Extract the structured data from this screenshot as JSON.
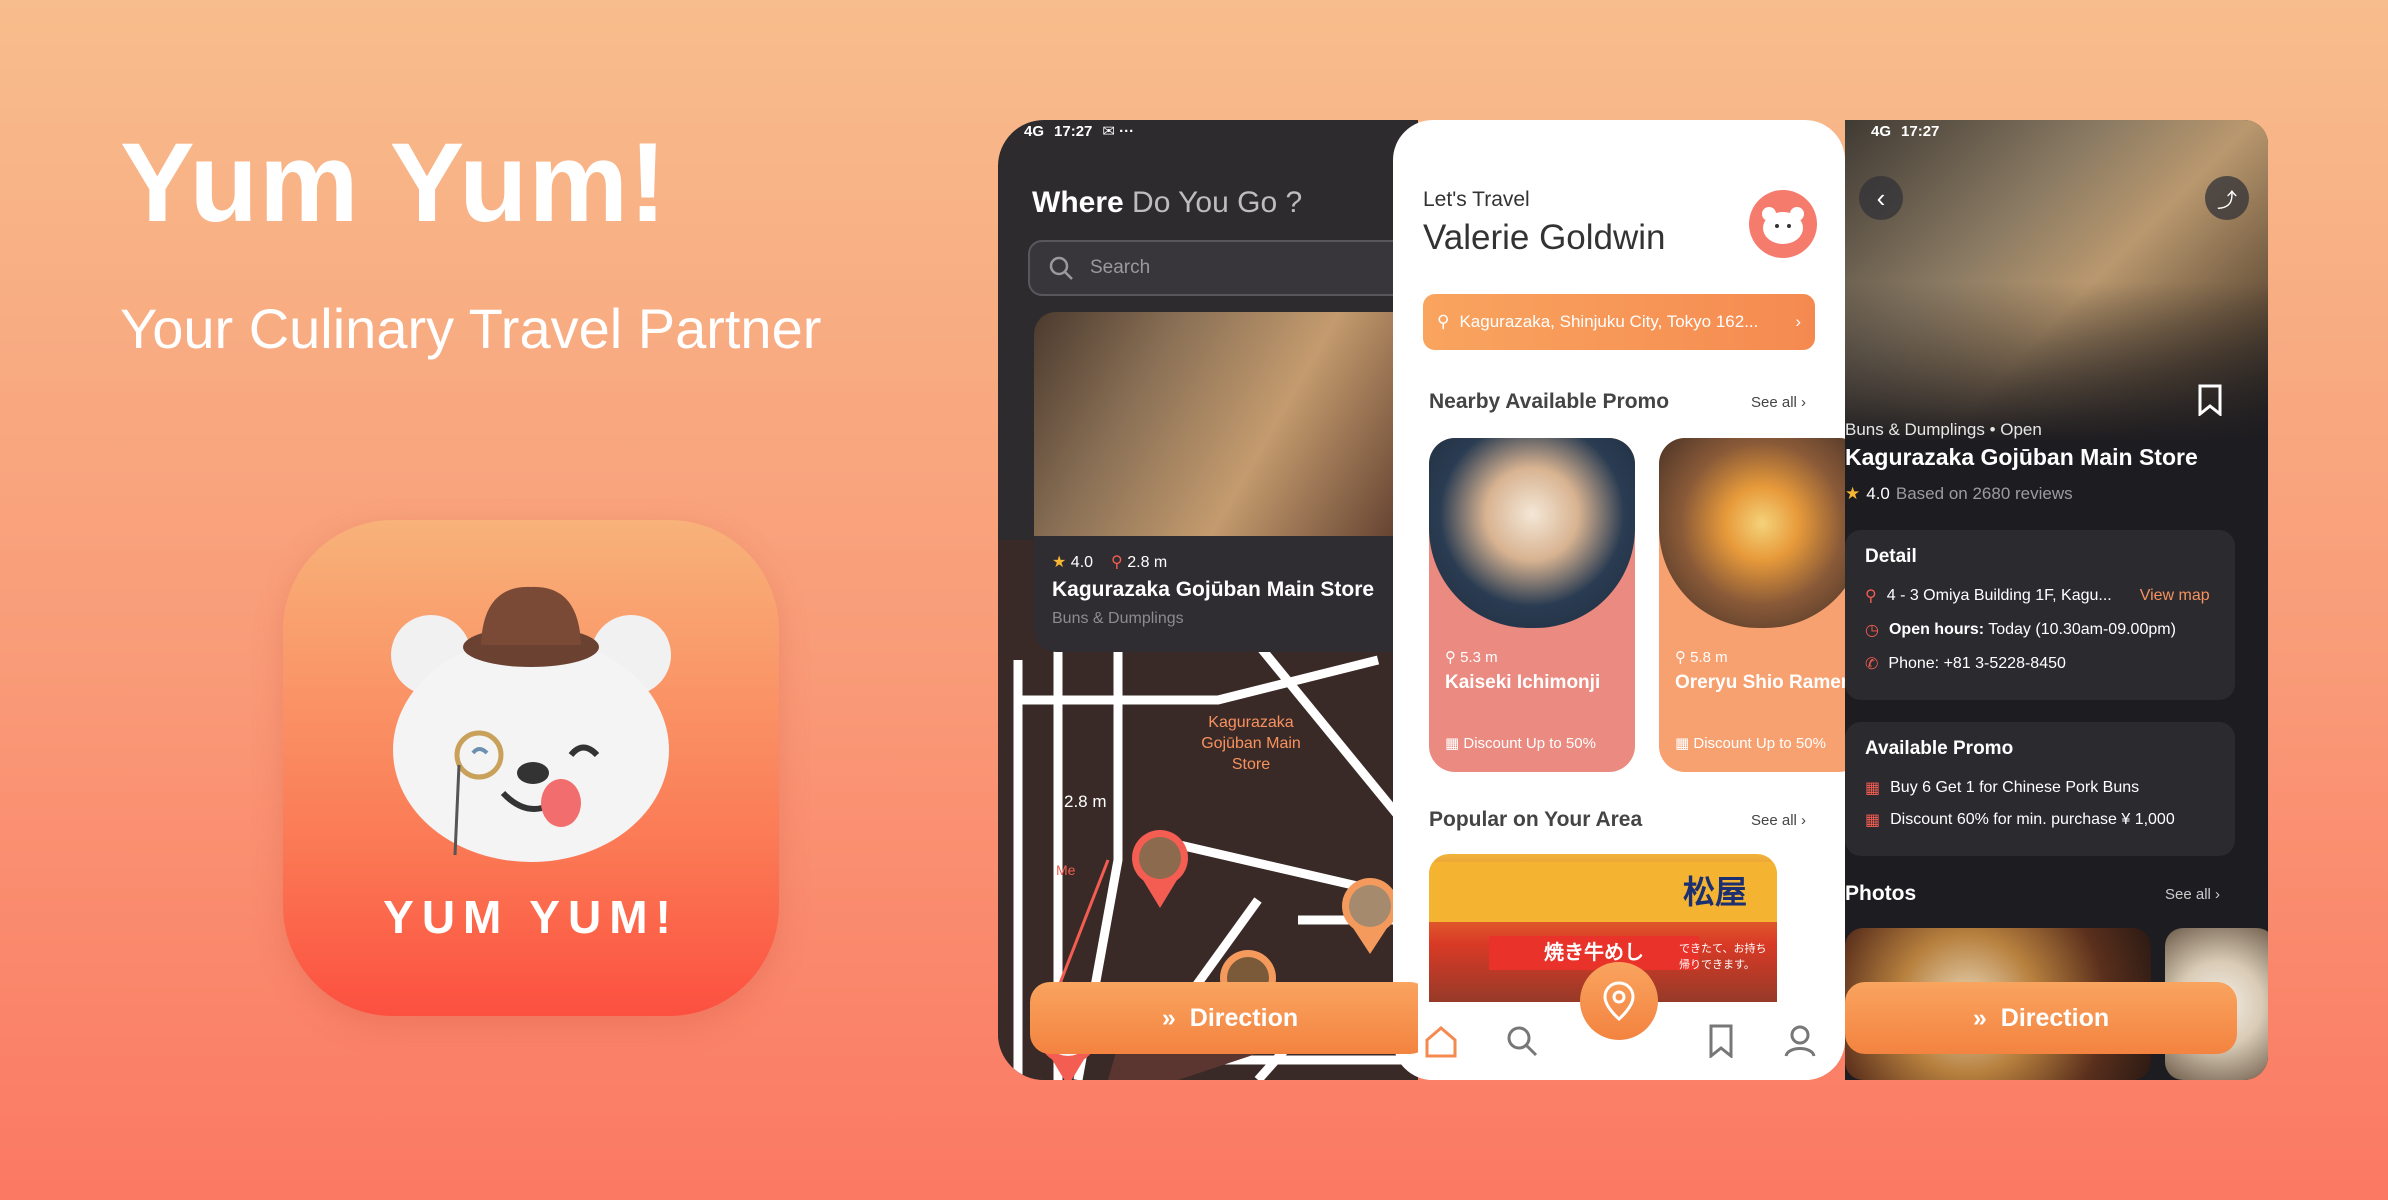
{
  "hero": {
    "title": "Yum Yum!",
    "subtitle": "Your Culinary Travel Partner",
    "icon_word": "YUM YUM!"
  },
  "colors": {
    "accent": "#f58a50",
    "accent_light": "#f9a45f",
    "dark_bg": "#2d2b2e",
    "coral": "#f57c6d"
  },
  "status_bar": {
    "time": "17:27",
    "signal": "4G"
  },
  "phone1": {
    "title_a": "Where",
    "title_b": "Do You Go ?",
    "search_placeholder": "Search",
    "card": {
      "rating": "4.0",
      "distance": "2.8 m",
      "name": "Kagurazaka Gojūban Main Store",
      "category": "Buns & Dumplings"
    },
    "map": {
      "pin_label": "Kagurazaka Gojūban Main Store",
      "distance_label": "2.8 m",
      "me_label": "Me"
    },
    "direction_label": "Direction"
  },
  "phone2": {
    "greeting": "Let's Travel",
    "user_name": "Valerie Goldwin",
    "location": "Kagurazaka, Shinjuku City, Tokyo 162...",
    "promo_section": {
      "title": "Nearby Available Promo",
      "see_all": "See all"
    },
    "promos": [
      {
        "distance": "5.3 m",
        "name": "Kaiseki Ichimonji",
        "discount": "Discount Up to 50%",
        "bg": "#ea8a80",
        "img": "#2a3c52"
      },
      {
        "distance": "5.8 m",
        "name": "Oreryu Shio Ramen",
        "discount": "Discount Up to 50%",
        "bg": "#f7a070",
        "img": "#6b4a34"
      }
    ],
    "popular_section": {
      "title": "Popular on Your Area",
      "see_all": "See all"
    },
    "popular": {
      "sign": "松屋",
      "banner": "焼き牛めし",
      "sub": "できたて、お持ち帰りできます。"
    },
    "nav": [
      "home-icon",
      "search-icon",
      "map-pin-icon",
      "bookmark-icon",
      "profile-icon"
    ]
  },
  "phone3": {
    "category": "Buns & Dumplings • Open",
    "name": "Kagurazaka Gojūban Main Store",
    "rating": "4.0",
    "reviews": "Based on 2680 reviews",
    "detail": {
      "title": "Detail",
      "address": "4 - 3 Omiya Building 1F, Kagu...",
      "view_map": "View map",
      "hours_label": "Open hours:",
      "hours_value": "Today (10.30am-09.00pm)",
      "phone": "Phone: +81 3-5228-8450"
    },
    "promo": {
      "title": "Available Promo",
      "items": [
        "Buy 6 Get 1 for Chinese Pork Buns",
        "Discount 60% for min. purchase ¥ 1,000"
      ]
    },
    "photos": {
      "title": "Photos",
      "see_all": "See all"
    },
    "direction_label": "Direction"
  }
}
